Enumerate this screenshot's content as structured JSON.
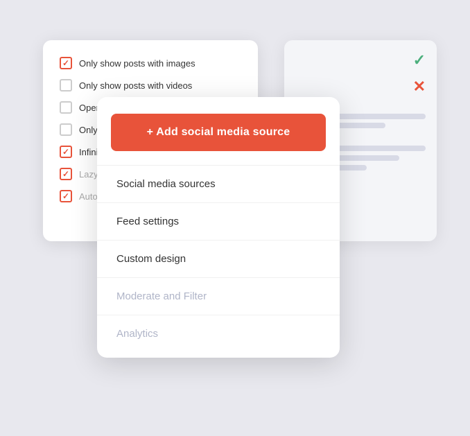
{
  "bg_card_left": {
    "checkboxes": [
      {
        "id": "cb1",
        "label": "Only show posts with images",
        "checked": true,
        "dimmed": false
      },
      {
        "id": "cb2",
        "label": "Only show posts with videos",
        "checked": false,
        "dimmed": false
      },
      {
        "id": "cb3",
        "label": "Open overla…",
        "checked": false,
        "dimmed": false
      },
      {
        "id": "cb4",
        "label": "Only play vi…",
        "checked": false,
        "dimmed": false
      },
      {
        "id": "cb5",
        "label": "Infinite scro…",
        "checked": true,
        "dimmed": false
      },
      {
        "id": "cb6",
        "label": "Lazy-load im…",
        "checked": true,
        "dimmed": true
      },
      {
        "id": "cb7",
        "label": "Auto-refres…",
        "checked": true,
        "dimmed": true
      }
    ]
  },
  "main_card": {
    "add_button_label": "+ Add social media source",
    "menu_items": [
      {
        "id": "social",
        "label": "Social media sources",
        "active": true,
        "muted": false
      },
      {
        "id": "feed",
        "label": "Feed settings",
        "active": false,
        "muted": false
      },
      {
        "id": "design",
        "label": "Custom design",
        "active": false,
        "muted": false
      },
      {
        "id": "moderate",
        "label": "Moderate and Filter",
        "active": false,
        "muted": true
      },
      {
        "id": "analytics",
        "label": "Analytics",
        "active": false,
        "muted": true
      }
    ]
  },
  "preview": {
    "check_icon": "✓",
    "x_icon": "✕"
  }
}
